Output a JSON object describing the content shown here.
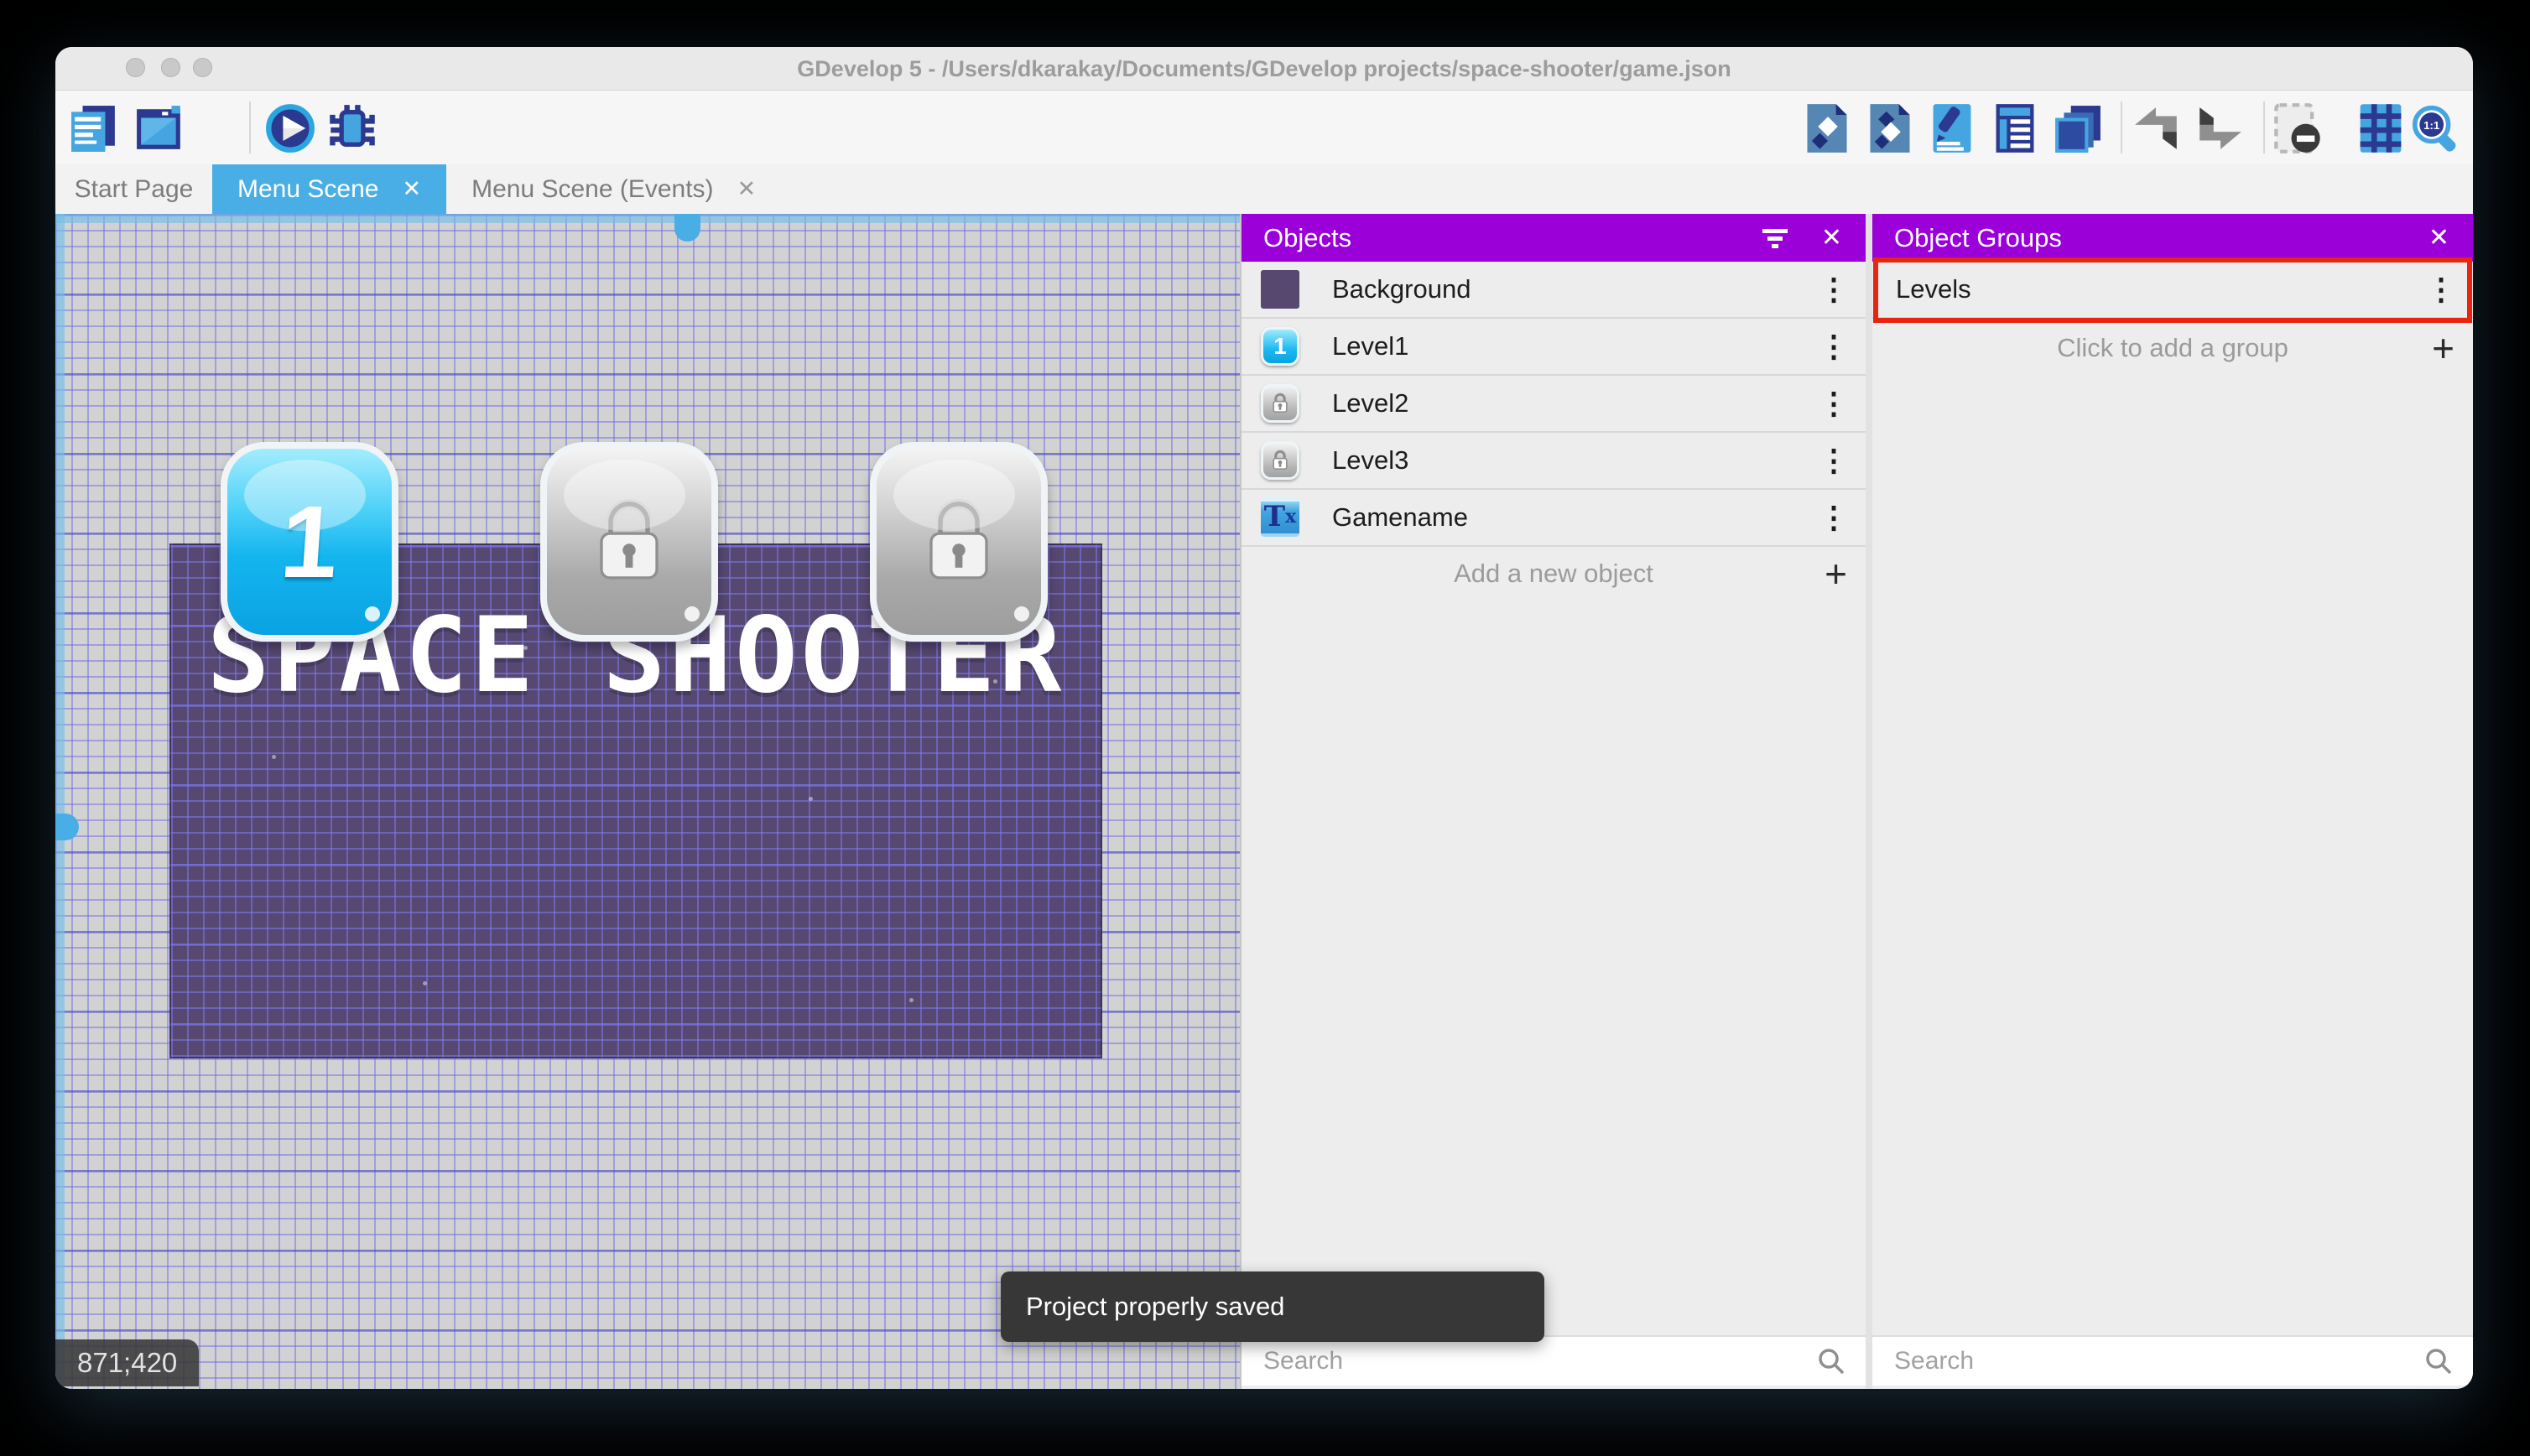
{
  "window": {
    "title": "GDevelop 5 - /Users/dkarakay/Documents/GDevelop projects/space-shooter/game.json"
  },
  "toolbar": {
    "left_icons": [
      "project-manager-icon",
      "scene-editor-icon",
      "play-icon",
      "debug-icon"
    ],
    "right_icons": [
      "objects-panel-icon",
      "object-groups-panel-icon",
      "properties-panel-icon",
      "instances-list-icon",
      "layers-panel-icon",
      "undo-icon",
      "redo-icon",
      "window-mask-icon",
      "grid-icon",
      "zoom-1-1-icon"
    ]
  },
  "tabs": [
    {
      "label": "Start Page",
      "active": false,
      "closable": false
    },
    {
      "label": "Menu Scene",
      "active": true,
      "closable": true
    },
    {
      "label": "Menu Scene (Events)",
      "active": false,
      "closable": true
    }
  ],
  "icons": {
    "close": "✕",
    "plus": "+",
    "menu_dots": "⋮"
  },
  "canvas": {
    "coordinates": "871;420",
    "game_title": "SPACE SHOOTER",
    "level_buttons": [
      {
        "label": "1",
        "locked": false
      },
      {
        "label": "",
        "locked": true
      },
      {
        "label": "",
        "locked": true
      }
    ]
  },
  "objects_panel": {
    "title": "Objects",
    "items": [
      {
        "name": "Background"
      },
      {
        "name": "Level1"
      },
      {
        "name": "Level2"
      },
      {
        "name": "Level3"
      },
      {
        "name": "Gamename"
      }
    ],
    "add_label": "Add a new object",
    "search_placeholder": "Search"
  },
  "object_groups_panel": {
    "title": "Object Groups",
    "items": [
      {
        "name": "Levels",
        "highlighted": true
      }
    ],
    "add_label": "Click to add a group",
    "search_placeholder": "Search"
  },
  "toast": {
    "message": "Project properly saved"
  },
  "colors": {
    "accent_blue": "#49aee6",
    "panel_header_purple": "#9a00d7",
    "highlight_red": "#e8250f",
    "game_background": "#564871",
    "toolbar_navy": "#2b3990",
    "toolbar_blue": "#45a5e0"
  }
}
